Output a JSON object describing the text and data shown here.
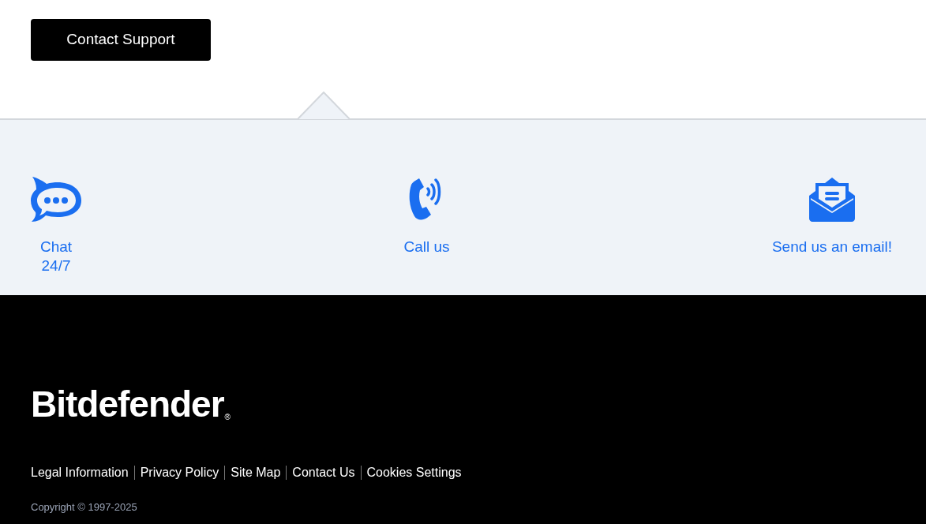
{
  "contact_button": {
    "label": "Contact Support"
  },
  "contact_options": [
    {
      "kind": "chat",
      "label": "Chat 24/7"
    },
    {
      "kind": "phone",
      "label": "Call us"
    },
    {
      "kind": "email",
      "label": "Send us an email!"
    }
  ],
  "footer": {
    "logo": {
      "text": "Bitdefender",
      "mark": "®"
    },
    "links": [
      "Legal Information",
      "Privacy Policy",
      "Site Map",
      "Contact Us",
      "Cookies Settings"
    ],
    "copyright": "Copyright © 1997-2025"
  }
}
